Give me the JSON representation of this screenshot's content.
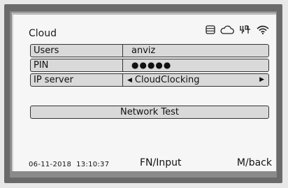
{
  "screen": {
    "title": "Cloud",
    "status_icons": [
      "storage-icon",
      "cloud-icon",
      "network-icon",
      "wifi-icon"
    ]
  },
  "fields": [
    {
      "label": "Users",
      "value": "anviz"
    },
    {
      "label": "PIN",
      "value": "●●●●●"
    },
    {
      "label": "IP server",
      "value": "CloudClocking",
      "selector": true
    }
  ],
  "buttons": {
    "network_test": "Network Test"
  },
  "footer": {
    "datetime": "06-11-2018  13:10:37",
    "fn_hint": "FN/Input",
    "back_hint": "M/back"
  },
  "colors": {
    "bezel": "#6a6a6a",
    "screen_bg": "#f6f6f6",
    "field_bg": "#d9d9d9"
  }
}
